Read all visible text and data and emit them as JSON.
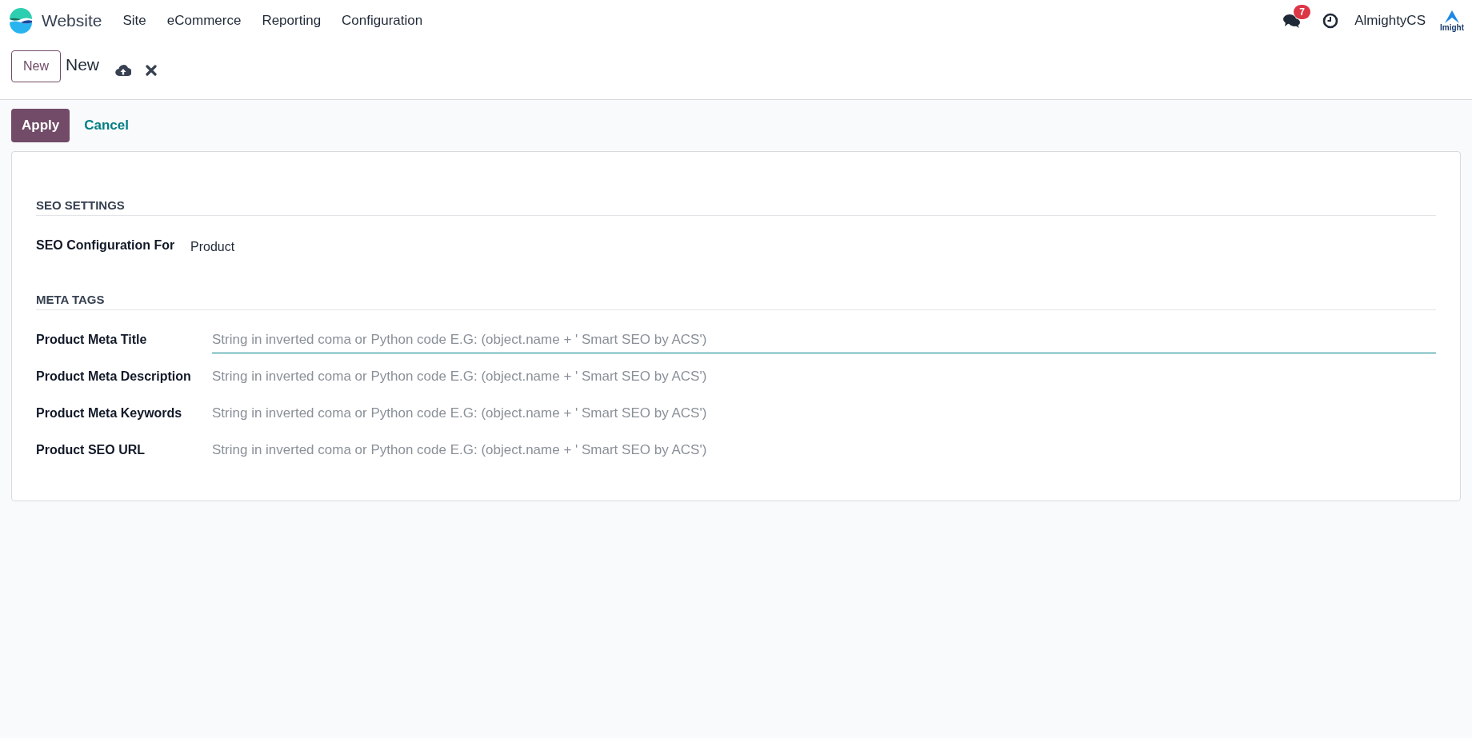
{
  "navbar": {
    "app_name": "Website",
    "menu": [
      "Site",
      "eCommerce",
      "Reporting",
      "Configuration"
    ],
    "messages_badge": "7",
    "user": "AlmightyCS",
    "company_logo_text": "Imight"
  },
  "control_panel": {
    "breadcrumb_button": "New",
    "record_title": "New"
  },
  "actions": {
    "apply": "Apply",
    "cancel": "Cancel"
  },
  "form": {
    "sections": [
      {
        "title": "SEO SETTINGS",
        "fields": [
          {
            "kind": "value",
            "label": "SEO Configuration For",
            "value": "Product"
          }
        ]
      },
      {
        "title": "META TAGS",
        "fields": [
          {
            "kind": "input",
            "label": "Product Meta Title",
            "placeholder": "String in inverted coma or Python code E.G: (object.name + ' Smart SEO by ACS')",
            "focused": true
          },
          {
            "kind": "input",
            "label": "Product Meta Description",
            "placeholder": "String in inverted coma or Python code E.G: (object.name + ' Smart SEO by ACS')",
            "focused": false
          },
          {
            "kind": "input",
            "label": "Product Meta Keywords",
            "placeholder": "String in inverted coma or Python code E.G: (object.name + ' Smart SEO by ACS')",
            "focused": false
          },
          {
            "kind": "input",
            "label": "Product SEO URL",
            "placeholder": "String in inverted coma or Python code E.G: (object.name + ' Smart SEO by ACS')",
            "focused": false
          }
        ]
      }
    ]
  }
}
